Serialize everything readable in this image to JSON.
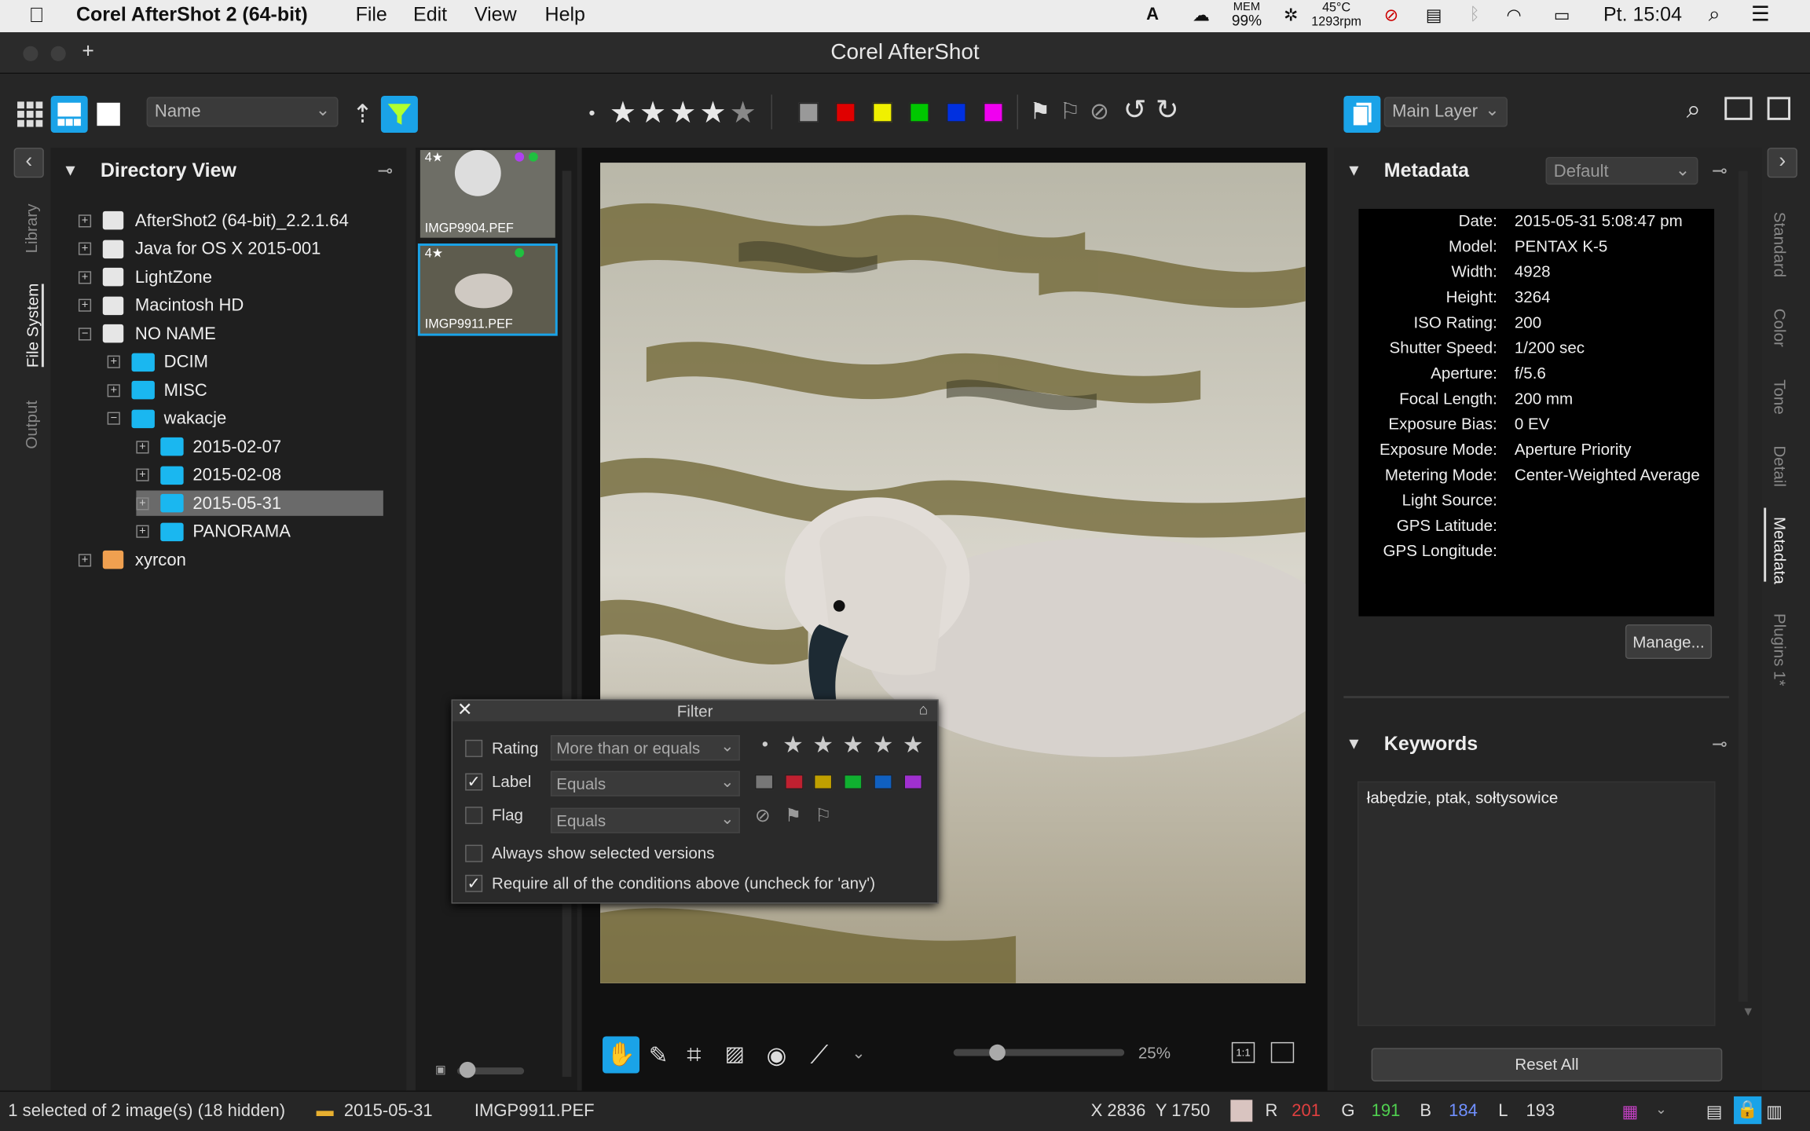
{
  "menubar": {
    "app": "Corel AfterShot 2 (64-bit)",
    "file": "File",
    "edit": "Edit",
    "view": "View",
    "help": "Help",
    "mem": "MEM",
    "mem_val": "99%",
    "temp": "45°C",
    "rpm": "1293rpm",
    "clock": "Pt. 15:04"
  },
  "window": {
    "title": "Corel AfterShot"
  },
  "toolbar": {
    "sort": "Name",
    "layer": "Main Layer"
  },
  "sidebar_tabs": [
    "Library",
    "File System",
    "Output"
  ],
  "right_tabs": [
    "Standard",
    "Color",
    "Tone",
    "Detail",
    "Metadata",
    "Plugins 1*"
  ],
  "directory": {
    "title": "Directory View",
    "items": [
      {
        "label": "AfterShot2 (64-bit)_2.2.1.64",
        "level": 0,
        "type": "drive"
      },
      {
        "label": "Java for OS X 2015-001",
        "level": 0,
        "type": "drive"
      },
      {
        "label": "LightZone",
        "level": 0,
        "type": "drive"
      },
      {
        "label": "Macintosh HD",
        "level": 0,
        "type": "drive"
      },
      {
        "label": "NO NAME",
        "level": 0,
        "type": "drive"
      },
      {
        "label": "DCIM",
        "level": 1,
        "type": "folder"
      },
      {
        "label": "MISC",
        "level": 1,
        "type": "folder"
      },
      {
        "label": "wakacje",
        "level": 1,
        "type": "folder"
      },
      {
        "label": "2015-02-07",
        "level": 2,
        "type": "folder"
      },
      {
        "label": "2015-02-08",
        "level": 2,
        "type": "folder"
      },
      {
        "label": "2015-05-31",
        "level": 2,
        "type": "folder",
        "selected": true
      },
      {
        "label": "PANORAMA",
        "level": 2,
        "type": "folder"
      },
      {
        "label": "xyrcon",
        "level": 0,
        "type": "home"
      }
    ]
  },
  "thumbs": [
    {
      "name": "IMGP9904.PEF",
      "rating": "4★"
    },
    {
      "name": "IMGP9911.PEF",
      "rating": "4★"
    }
  ],
  "metadata": {
    "title": "Metadata",
    "preset": "Default",
    "fields": [
      {
        "k": "Date:",
        "v": "2015-05-31 5:08:47 pm"
      },
      {
        "k": "Model:",
        "v": "PENTAX K-5"
      },
      {
        "k": "Width:",
        "v": "4928"
      },
      {
        "k": "Height:",
        "v": "3264"
      },
      {
        "k": "ISO Rating:",
        "v": "200"
      },
      {
        "k": "Shutter Speed:",
        "v": "1/200 sec"
      },
      {
        "k": "Aperture:",
        "v": "f/5.6"
      },
      {
        "k": "Focal Length:",
        "v": "200 mm"
      },
      {
        "k": "Exposure Bias:",
        "v": "0 EV"
      },
      {
        "k": "Exposure Mode:",
        "v": "Aperture Priority"
      },
      {
        "k": "Metering Mode:",
        "v": "Center-Weighted Average"
      },
      {
        "k": "Light Source:",
        "v": ""
      },
      {
        "k": "GPS Latitude:",
        "v": ""
      },
      {
        "k": "GPS Longitude:",
        "v": ""
      }
    ],
    "manage": "Manage..."
  },
  "keywords": {
    "title": "Keywords",
    "text": "łabędzie, ptak, sołtysowice"
  },
  "filter": {
    "title": "Filter",
    "rating": "Rating",
    "rating_op": "More than or equals",
    "label": "Label",
    "label_op": "Equals",
    "flag": "Flag",
    "flag_op": "Equals",
    "always": "Always show selected versions",
    "require": "Require all of the conditions above (uncheck for 'any')"
  },
  "viewer": {
    "zoom": "25%"
  },
  "reset": "Reset All",
  "status": {
    "selection": "1 selected of 2 image(s) (18 hidden)",
    "folder": "2015-05-31",
    "file": "IMGP9911.PEF",
    "x": "X 2836",
    "y": "Y 1750",
    "r_label": "R",
    "r": "201",
    "g_label": "G",
    "g": "191",
    "b_label": "B",
    "b": "184",
    "l_label": "L",
    "l": "193"
  },
  "colors": {
    "accent": "#1aa3e8",
    "red": "#e00000",
    "yellow": "#f0f000",
    "green": "#00c800",
    "blue": "#0030e0",
    "magenta": "#f000f0",
    "gray": "#999999"
  }
}
